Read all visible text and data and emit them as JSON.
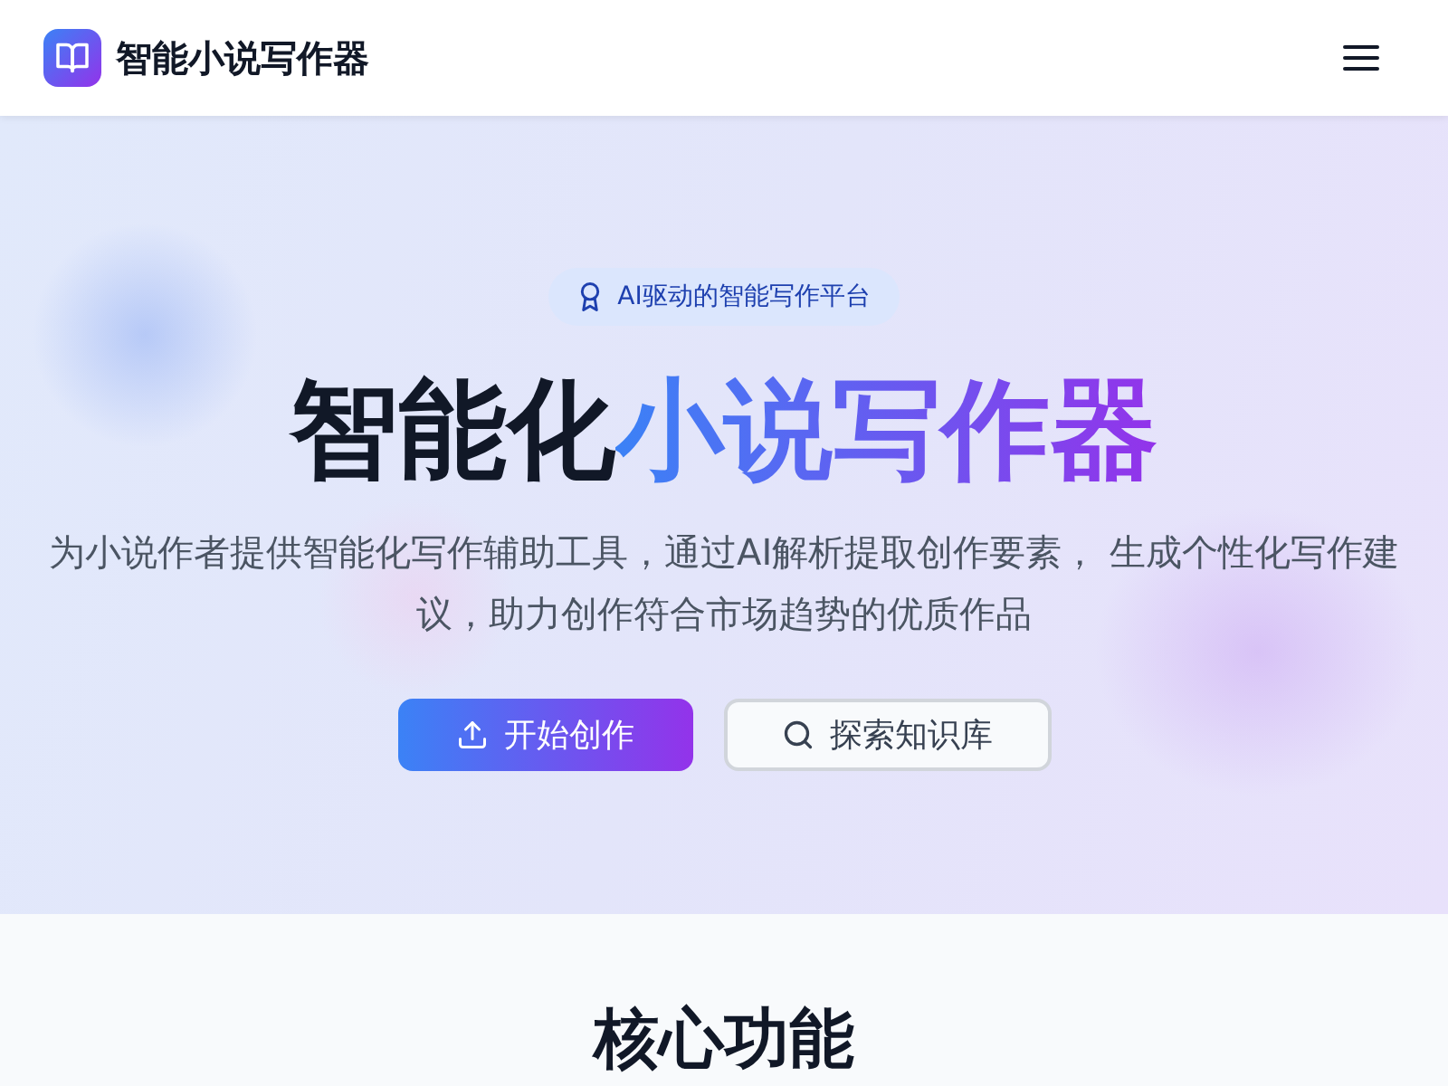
{
  "header": {
    "logo_text": "智能小说写作器"
  },
  "hero": {
    "badge": "AI驱动的智能写作平台",
    "title": {
      "plain": "智能化",
      "highlight": "小说写作器"
    },
    "subtitle": "为小说作者提供智能化写作辅助工具，通过AI解析提取创作要素， 生成个性化写作建议，助力创作符合市场趋势的优质作品",
    "buttons": [
      {
        "label": "开始创作",
        "kind": "primary"
      },
      {
        "label": "探索知识库",
        "kind": "secondary"
      }
    ]
  },
  "features": {
    "heading": "核心功能"
  }
}
